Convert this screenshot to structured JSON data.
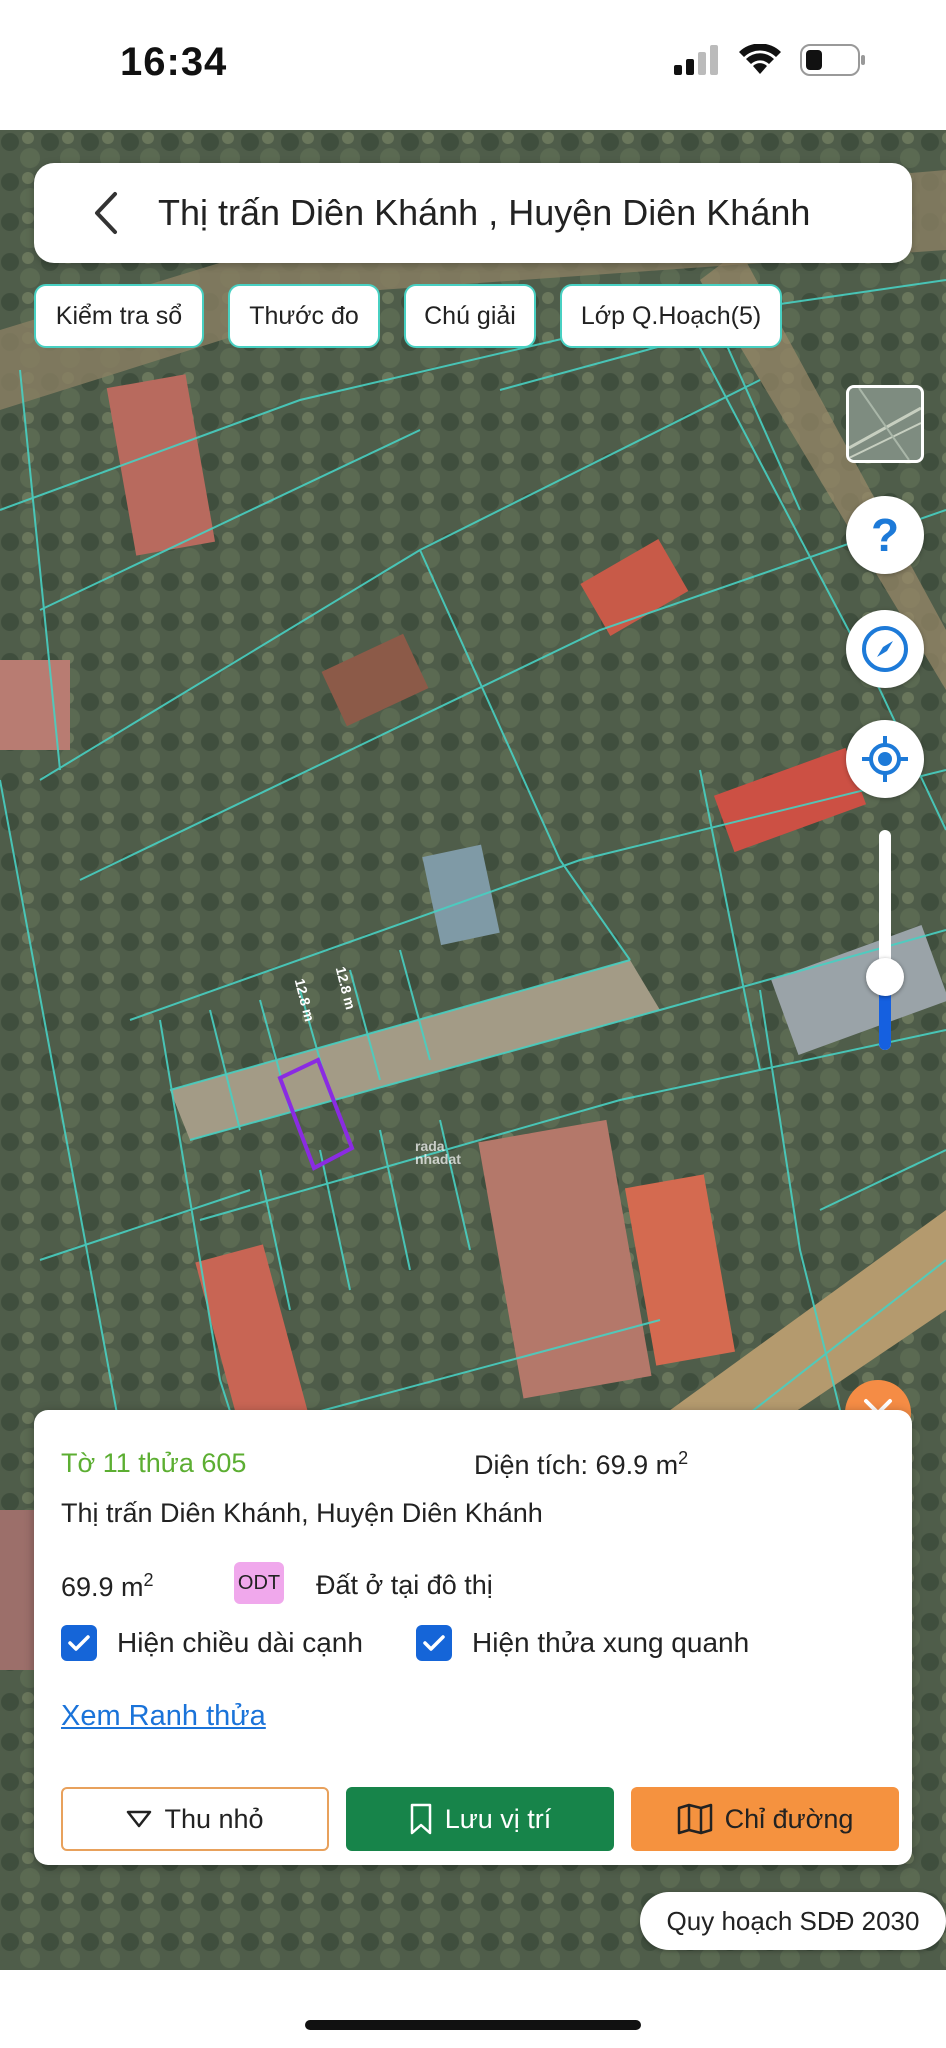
{
  "status": {
    "time": "16:34"
  },
  "header": {
    "title": "Thị trấn Diên Khánh , Huyện Diên Khánh"
  },
  "chips": [
    {
      "label": "Kiểm tra sổ"
    },
    {
      "label": "Thước đo"
    },
    {
      "label": "Chú giải"
    },
    {
      "label": "Lớp Q.Hoạch(5)"
    }
  ],
  "map": {
    "edge_a": "12.8 m",
    "edge_b": "12.8 m",
    "watermark_top": "rada",
    "watermark_bottom": "nhadat"
  },
  "controls": {
    "help": "?"
  },
  "panel": {
    "sheet": "Tờ 11 thửa 605",
    "area_label": "Diện tích: 69.9 m",
    "area_sup": "2",
    "address": "Thị trấn Diên Khánh, Huyện Diên Khánh",
    "area_value": "69.9 m",
    "area_value_sup": "2",
    "land_code": "ODT",
    "land_type": "Đất ở tại đô thị",
    "checkbox_edges": "Hiện chiều dài cạnh",
    "checkbox_neighbors": "Hiện thửa xung quanh",
    "link": "Xem Ranh thửa",
    "btn_shrink": "Thu nhỏ",
    "btn_save": "Lưu vị trí",
    "btn_route": "Chỉ đường"
  },
  "plan_badge": "Quy hoạch SDĐ 2030",
  "colors": {
    "accent_green": "#17844a",
    "accent_orange": "#f5923f",
    "parcel_lines": "#48d0c2",
    "selected_parcel": "#8a2be2"
  }
}
